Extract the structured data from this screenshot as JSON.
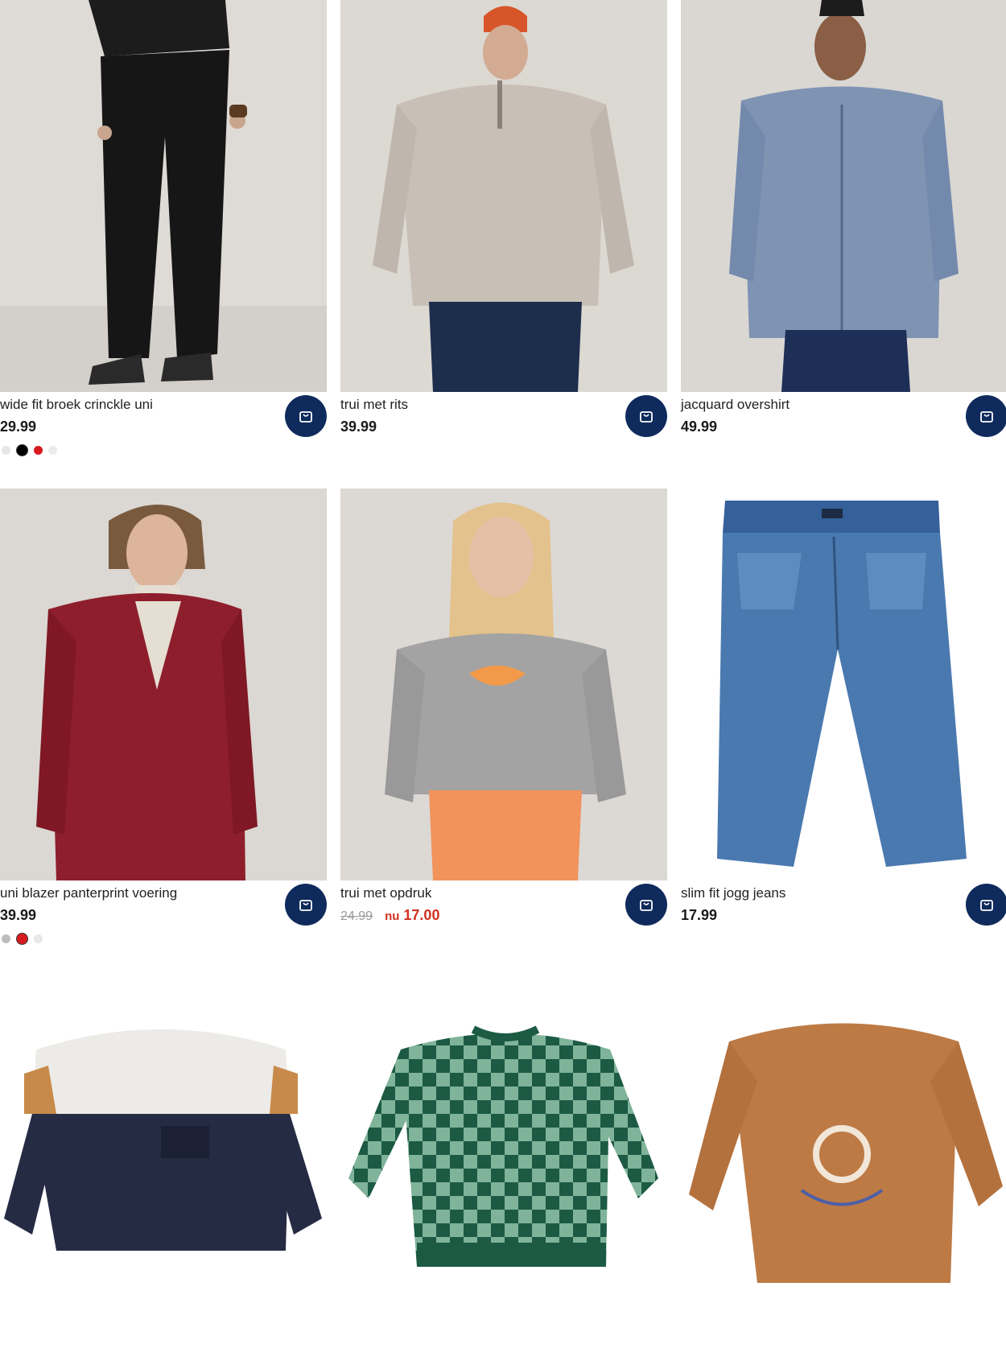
{
  "products": [
    {
      "title": "wide fit broek crinckle uni",
      "price": "29.99",
      "swatches": [
        "#e6e6e6",
        "#000000",
        "#d71920",
        "#ececec"
      ],
      "selected": 1
    },
    {
      "title": "trui met rits",
      "price": "39.99"
    },
    {
      "title": "jacquard overshirt",
      "price": "49.99"
    },
    {
      "title": "uni blazer panterprint voering",
      "price": "39.99",
      "swatches": [
        "#bdbdbd",
        "#d71920",
        "#e8e8e8"
      ],
      "selected": 1
    },
    {
      "title": "trui met opdruk",
      "old_price": "24.99",
      "nu_label": "nu",
      "new_price": "17.00"
    },
    {
      "title": "slim fit jogg jeans",
      "price": "17.99"
    }
  ],
  "colors": {
    "cart_button": "#0f2a5c",
    "sale": "#d2301f"
  },
  "icons": {
    "cart": "shopping-bag-icon"
  }
}
